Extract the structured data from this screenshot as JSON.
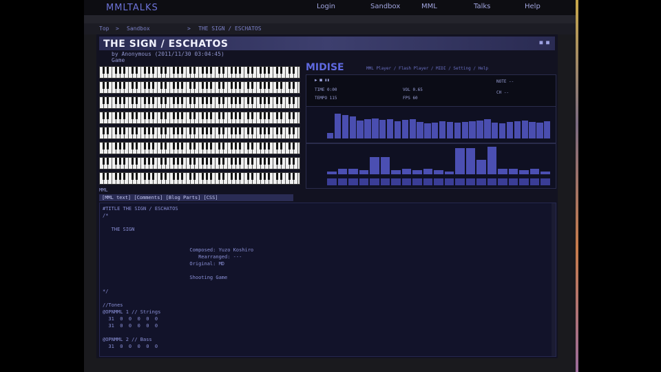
{
  "nav": {
    "logo": "MMLTALKS",
    "items": [
      "Login",
      "Sandbox",
      "MML",
      "Talks",
      "Help"
    ]
  },
  "breadcrumb": [
    "Top",
    "Sandbox",
    "THE SIGN / ESCHATOS"
  ],
  "song": {
    "title": "THE SIGN / ESCHATOS",
    "byline": "by Anonymous  (2011/11/30 03:04:45)",
    "genre": "Game"
  },
  "player": {
    "logo": "MIDISE",
    "link": "MML Player / Flash Player / MIDI / Setting / Help",
    "stats": {
      "time": "TIME  0:00",
      "tempo": "TEMPO  115",
      "vol": "VOL  0.65",
      "fps": "FPS  60",
      "note": "NOTE  --",
      "ch": "CH  --"
    },
    "spectrum_values": [
      0.2,
      0.9,
      0.85,
      0.8,
      0.65,
      0.7,
      0.72,
      0.68,
      0.7,
      0.62,
      0.68,
      0.7,
      0.6,
      0.55,
      0.58,
      0.62,
      0.6,
      0.58,
      0.6,
      0.62,
      0.66,
      0.7,
      0.58,
      0.55,
      0.6,
      0.62,
      0.65,
      0.6,
      0.58,
      0.62
    ],
    "volume_values": [
      0.1,
      0.2,
      0.2,
      0.15,
      0.6,
      0.6,
      0.15,
      0.2,
      0.15,
      0.2,
      0.15,
      0.1,
      0.9,
      0.9,
      0.5,
      0.95,
      0.2,
      0.2,
      0.15,
      0.2,
      0.1
    ]
  },
  "mml": {
    "heading": "MML",
    "links_label": "[MML text] [Comments] [Blog Parts] [CSS]",
    "code_lines": [
      "#TITLE THE SIGN / ESCHATOS",
      "/*",
      "",
      "   THE SIGN",
      "",
      "",
      "                              Composed: Yuzo Koshiro",
      "                                 Rearranged: ---",
      "                              Original: MD",
      "",
      "                              Shooting Game",
      "",
      "*/",
      "",
      "//Tones",
      "@OPNMML 1 // Strings",
      "  31  0  0  0  0  0",
      "  31  0  0  0  0  0",
      "",
      "@OPNMML 2 // Bass",
      "  31  0  0  0  0  0"
    ]
  }
}
